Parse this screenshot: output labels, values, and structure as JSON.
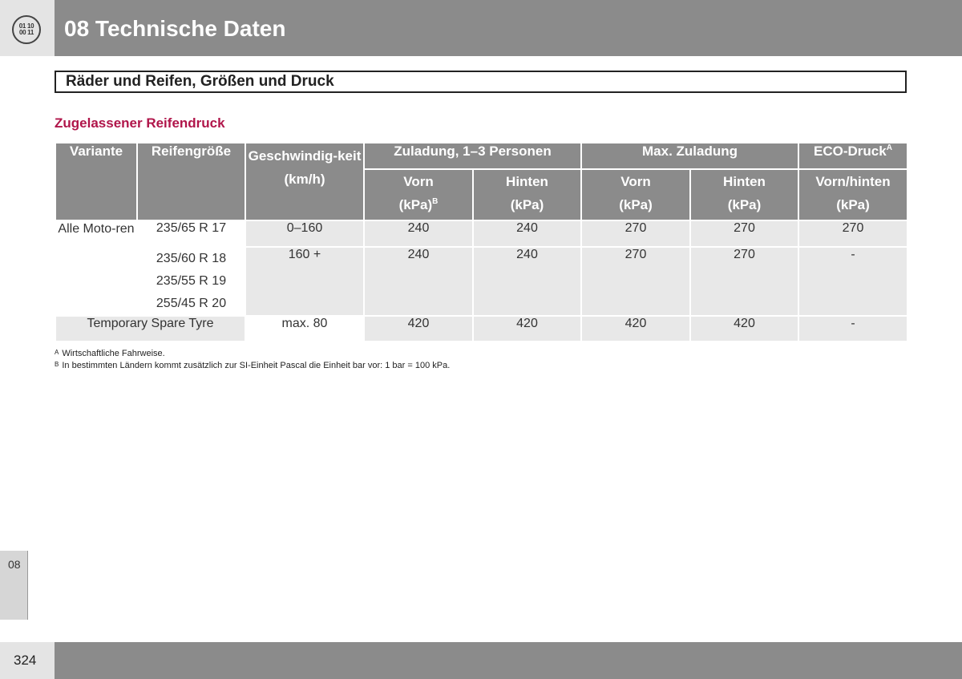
{
  "header": {
    "chapter_icon_lines": [
      "01 10",
      "00 11"
    ],
    "title": "08 Technische Daten"
  },
  "section_title": "Räder und Reifen, Größen und Druck",
  "subtitle": "Zugelassener Reifendruck",
  "table": {
    "headers": {
      "variante": "Variante",
      "reifengroesse": "Reifengröße",
      "geschwindigkeit": "Geschwindig-keit",
      "geschwindigkeit_unit": "(km/h)",
      "zuladung_group": "Zuladung, 1–3 Personen",
      "max_group": "Max. Zuladung",
      "eco_group": "ECO-Druck",
      "eco_sup": "A",
      "vorn": "Vorn",
      "hinten": "Hinten",
      "vorn_hinten": "Vorn/hinten",
      "unit_kpa": "(kPa)",
      "unit_sup": "B"
    },
    "rows": [
      {
        "variante": "Alle Moto-ren",
        "size": "235/65 R 17",
        "speed": "0–160",
        "v1": "240",
        "h1": "240",
        "v2": "270",
        "h2": "270",
        "eco": "270"
      },
      {
        "sizes": [
          "235/60 R 18",
          "235/55 R 19",
          "255/45 R 20"
        ],
        "speed": "160 +",
        "v1": "240",
        "h1": "240",
        "v2": "270",
        "h2": "270",
        "eco": "-"
      },
      {
        "variante": "Temporary Spare Tyre",
        "speed": "max. 80",
        "v1": "420",
        "h1": "420",
        "v2": "420",
        "h2": "420",
        "eco": "-"
      }
    ]
  },
  "footnotes": [
    {
      "mark": "A",
      "text": "Wirtschaftliche Fahrweise."
    },
    {
      "mark": "B",
      "text": "In bestimmten Ländern kommt zusätzlich zur SI-Einheit Pascal die Einheit bar vor: 1 bar = 100 kPa."
    }
  ],
  "side_tab": "08",
  "page_number": "324"
}
